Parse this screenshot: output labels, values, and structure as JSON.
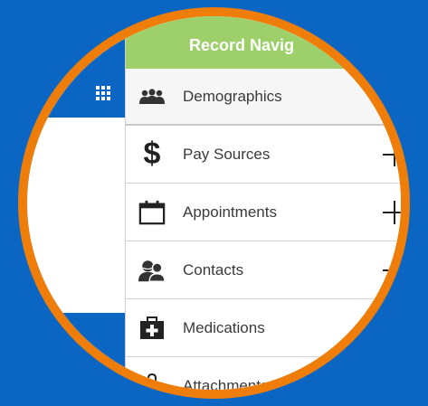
{
  "panel": {
    "title": "Record Navig"
  },
  "menu": [
    {
      "label": "Demographics",
      "icon": "people-icon",
      "has_add": false
    },
    {
      "label": "Pay Sources",
      "icon": "dollar-icon",
      "has_add": true
    },
    {
      "label": "Appointments",
      "icon": "calendar-icon",
      "has_add": true
    },
    {
      "label": "Contacts",
      "icon": "contacts-icon",
      "has_add": true
    },
    {
      "label": "Medications",
      "icon": "medkit-icon",
      "has_add": false
    },
    {
      "label": "Attachments",
      "icon": "paperclip-icon",
      "has_add": false
    }
  ],
  "colors": {
    "background": "#0b66c3",
    "ring": "#ef7d0a",
    "header": "#9dcf6a"
  }
}
